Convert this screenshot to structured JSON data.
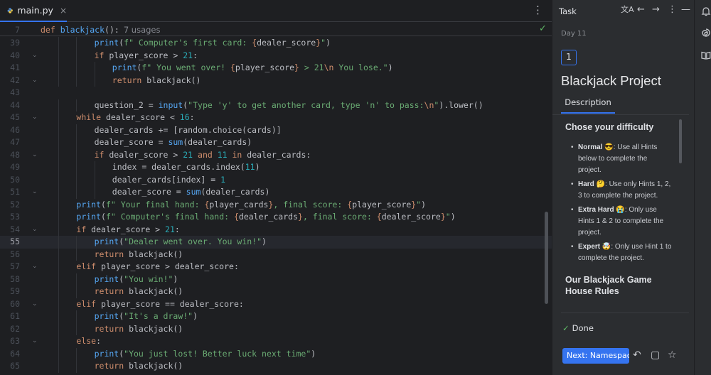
{
  "editor": {
    "tab": {
      "filename": "main.py",
      "close": "×"
    },
    "menu_glyph": "⋮",
    "sticky": {
      "line_number": "7",
      "keyword": "def",
      "function": "blackjack",
      "rest": "():",
      "usages": "7 usages"
    },
    "current_line": 55,
    "lines": [
      {
        "n": "39",
        "indent": 3,
        "tokens": [
          [
            "bi",
            "print"
          ],
          [
            "",
            "("
          ],
          [
            "str",
            "f\" Computer's first card: "
          ],
          [
            "brace",
            "{"
          ],
          [
            "",
            "dealer_score"
          ],
          [
            "brace",
            "}"
          ],
          [
            "str",
            "\""
          ],
          [
            "",
            ")"
          ]
        ]
      },
      {
        "n": "40",
        "indent": 3,
        "fold": true,
        "tokens": [
          [
            "kw",
            "if"
          ],
          [
            "",
            " player_score > "
          ],
          [
            "num",
            "21"
          ],
          [
            "",
            ":"
          ]
        ]
      },
      {
        "n": "41",
        "indent": 4,
        "tokens": [
          [
            "bi",
            "print"
          ],
          [
            "",
            "("
          ],
          [
            "str",
            "f\" You went over! "
          ],
          [
            "brace",
            "{"
          ],
          [
            "",
            "player_score"
          ],
          [
            "brace",
            "}"
          ],
          [
            "str",
            " > 21"
          ],
          [
            "esc",
            "\\n"
          ],
          [
            "str",
            " You lose.\""
          ],
          [
            "",
            ")"
          ]
        ]
      },
      {
        "n": "42",
        "indent": 4,
        "fold": true,
        "tokens": [
          [
            "kw",
            "return"
          ],
          [
            "",
            " blackjack()"
          ]
        ]
      },
      {
        "n": "43",
        "indent": 0,
        "tokens": []
      },
      {
        "n": "44",
        "indent": 3,
        "tokens": [
          [
            "",
            "question_2 = "
          ],
          [
            "bi",
            "input"
          ],
          [
            "",
            "("
          ],
          [
            "str",
            "\"Type 'y' to get another card, type 'n' to pass:"
          ],
          [
            "esc",
            "\\n"
          ],
          [
            "str",
            "\""
          ],
          [
            "",
            ").lower()"
          ]
        ]
      },
      {
        "n": "45",
        "indent": 2,
        "fold": true,
        "tokens": [
          [
            "kw",
            "while"
          ],
          [
            "",
            " dealer_score < "
          ],
          [
            "num",
            "16"
          ],
          [
            "",
            ":"
          ]
        ]
      },
      {
        "n": "46",
        "indent": 3,
        "tokens": [
          [
            "",
            "dealer_cards += [random.choice(cards)]"
          ]
        ]
      },
      {
        "n": "47",
        "indent": 3,
        "tokens": [
          [
            "",
            "dealer_score = "
          ],
          [
            "bi",
            "sum"
          ],
          [
            "",
            "(dealer_cards)"
          ]
        ]
      },
      {
        "n": "48",
        "indent": 3,
        "fold": true,
        "tokens": [
          [
            "kw",
            "if"
          ],
          [
            "",
            " dealer_score > "
          ],
          [
            "num",
            "21"
          ],
          [
            "kw",
            " and "
          ],
          [
            "num",
            "11"
          ],
          [
            "kw",
            " in"
          ],
          [
            "",
            " dealer_cards:"
          ]
        ]
      },
      {
        "n": "49",
        "indent": 4,
        "tokens": [
          [
            "",
            "index = dealer_cards.index("
          ],
          [
            "num",
            "11"
          ],
          [
            "",
            ")"
          ]
        ]
      },
      {
        "n": "50",
        "indent": 4,
        "tokens": [
          [
            "",
            "dealer_cards[index] = "
          ],
          [
            "num",
            "1"
          ]
        ]
      },
      {
        "n": "51",
        "indent": 4,
        "fold": true,
        "tokens": [
          [
            "",
            "dealer_score = "
          ],
          [
            "bi",
            "sum"
          ],
          [
            "",
            "(dealer_cards)"
          ]
        ]
      },
      {
        "n": "52",
        "indent": 2,
        "tokens": [
          [
            "bi",
            "print"
          ],
          [
            "",
            "("
          ],
          [
            "str",
            "f\" Your final hand: "
          ],
          [
            "brace",
            "{"
          ],
          [
            "",
            "player_cards"
          ],
          [
            "brace",
            "}"
          ],
          [
            "str",
            ", final score: "
          ],
          [
            "brace",
            "{"
          ],
          [
            "",
            "player_score"
          ],
          [
            "brace",
            "}"
          ],
          [
            "str",
            "\""
          ],
          [
            "",
            ")"
          ]
        ]
      },
      {
        "n": "53",
        "indent": 2,
        "tokens": [
          [
            "bi",
            "print"
          ],
          [
            "",
            "("
          ],
          [
            "str",
            "f\" Computer's final hand: "
          ],
          [
            "brace",
            "{"
          ],
          [
            "",
            "dealer_cards"
          ],
          [
            "brace",
            "}"
          ],
          [
            "str",
            ", final score: "
          ],
          [
            "brace",
            "{"
          ],
          [
            "",
            "dealer_score"
          ],
          [
            "brace",
            "}"
          ],
          [
            "str",
            "\""
          ],
          [
            "",
            ")"
          ]
        ]
      },
      {
        "n": "54",
        "indent": 2,
        "fold": true,
        "tokens": [
          [
            "kw",
            "if"
          ],
          [
            "",
            " dealer_score > "
          ],
          [
            "num",
            "21"
          ],
          [
            "",
            ":"
          ]
        ]
      },
      {
        "n": "55",
        "indent": 3,
        "tokens": [
          [
            "bi",
            "print"
          ],
          [
            "",
            "("
          ],
          [
            "str",
            "\"Dealer went over. You win!\""
          ],
          [
            "",
            ")"
          ]
        ]
      },
      {
        "n": "56",
        "indent": 3,
        "tokens": [
          [
            "kw",
            "return"
          ],
          [
            "",
            " blackjack()"
          ]
        ]
      },
      {
        "n": "57",
        "indent": 2,
        "fold": true,
        "tokens": [
          [
            "kw",
            "elif"
          ],
          [
            "",
            " player_score > dealer_score:"
          ]
        ]
      },
      {
        "n": "58",
        "indent": 3,
        "tokens": [
          [
            "bi",
            "print"
          ],
          [
            "",
            "("
          ],
          [
            "str",
            "\"You win!\""
          ],
          [
            "",
            ")"
          ]
        ]
      },
      {
        "n": "59",
        "indent": 3,
        "tokens": [
          [
            "kw",
            "return"
          ],
          [
            "",
            " blackjack()"
          ]
        ]
      },
      {
        "n": "60",
        "indent": 2,
        "fold": true,
        "tokens": [
          [
            "kw",
            "elif"
          ],
          [
            "",
            " player_score == dealer_score:"
          ]
        ]
      },
      {
        "n": "61",
        "indent": 3,
        "tokens": [
          [
            "bi",
            "print"
          ],
          [
            "",
            "("
          ],
          [
            "str",
            "\"It's a draw!\""
          ],
          [
            "",
            ")"
          ]
        ]
      },
      {
        "n": "62",
        "indent": 3,
        "tokens": [
          [
            "kw",
            "return"
          ],
          [
            "",
            " blackjack()"
          ]
        ]
      },
      {
        "n": "63",
        "indent": 2,
        "fold": true,
        "tokens": [
          [
            "kw",
            "else"
          ],
          [
            "",
            ":"
          ]
        ]
      },
      {
        "n": "64",
        "indent": 3,
        "tokens": [
          [
            "bi",
            "print"
          ],
          [
            "",
            "("
          ],
          [
            "str",
            "\"You just lost! Better luck next time\""
          ],
          [
            "",
            ")"
          ]
        ]
      },
      {
        "n": "65",
        "indent": 3,
        "tokens": [
          [
            "kw",
            "return"
          ],
          [
            "",
            " blackjack()"
          ]
        ]
      }
    ]
  },
  "task_panel": {
    "title": "Task",
    "header_icons": {
      "translate": "文A",
      "back": "←",
      "forward": "→",
      "menu": "⋮",
      "minimize": "—"
    },
    "day": "Day 11",
    "step_number": "1",
    "project_title": "Blackjack Project",
    "tab_label": "Description",
    "heading": "Chose your difficulty",
    "difficulties": [
      {
        "level": "Normal",
        "emoji": "😎",
        "text": ": Use all Hints below to complete the project."
      },
      {
        "level": "Hard",
        "emoji": "🤔",
        "text": ": Use only Hints 1, 2, 3 to complete the project."
      },
      {
        "level": "Extra Hard",
        "emoji": "😭",
        "text": ": Only use Hints 1 & 2 to complete the project."
      },
      {
        "level": "Expert",
        "emoji": "🤯",
        "text": ": Only use Hint 1 to complete the project."
      }
    ],
    "second_heading": "Our Blackjack Game House Rules",
    "done_label": "Done",
    "done_check": "✓",
    "next_button": "Next: Namespaces",
    "footer_icons": {
      "undo": "↶",
      "comment": "▢",
      "star": "☆"
    }
  },
  "right_strip": {
    "icons": [
      "notifications-icon",
      "ai-spiral-icon",
      "learn-book-icon"
    ]
  },
  "colors": {
    "keyword": "#cf8e6d",
    "builtin": "#56a8f5",
    "string": "#6aab73",
    "number": "#2aacb8",
    "accent": "#3574f0",
    "success": "#5fb865"
  }
}
